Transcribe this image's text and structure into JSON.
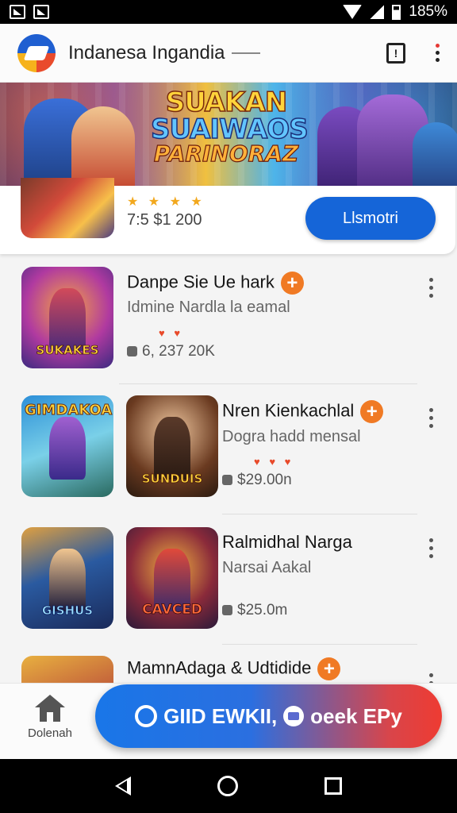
{
  "status_bar": {
    "battery_text": "185%"
  },
  "app_bar": {
    "title": "Indanesa Ingandia",
    "icons": [
      "app-logo",
      "report-icon",
      "overflow-menu-icon"
    ]
  },
  "banner": {
    "title_line1": "SUAKAN",
    "title_line2": "SUAIWAOS",
    "title_line3": "PARINORAZ"
  },
  "partial_item": {
    "stars": "★ ★ ★ ★",
    "price": "7:5 $1 200",
    "download_label": "Llsmotri"
  },
  "items": [
    {
      "title": "Danpe Sie Ue hark",
      "subtitle": "Idmine Nardla la eamal",
      "hearts": "♥ ♥",
      "meta": "6, 237 20K",
      "thumb_label": "SUKAKES"
    },
    {
      "title": "Nren Kienkachlal",
      "subtitle": "Dogra hadd mensal",
      "hearts": "♥ ♥ ♥",
      "meta": "$29.00n",
      "thumb_label": "SUNDUIS",
      "thumb_top_label": "GIMDAKOA"
    },
    {
      "title": "Ralmidhal Narga",
      "subtitle": "Narsai Aakal",
      "meta": "$25.0m",
      "thumb_label": "CAVCED",
      "thumb_top_label": "GISHUS"
    },
    {
      "title": "MamnAdaga & Udtidide"
    }
  ],
  "bottom_nav": {
    "home_label": "Dolenah"
  },
  "cta": {
    "label_left": "GIID EWKII,",
    "label_right": "oeek EPy"
  },
  "colors": {
    "accent_blue": "#1565d8",
    "plus_orange": "#f07a24",
    "cta_red": "#ee3b32"
  }
}
